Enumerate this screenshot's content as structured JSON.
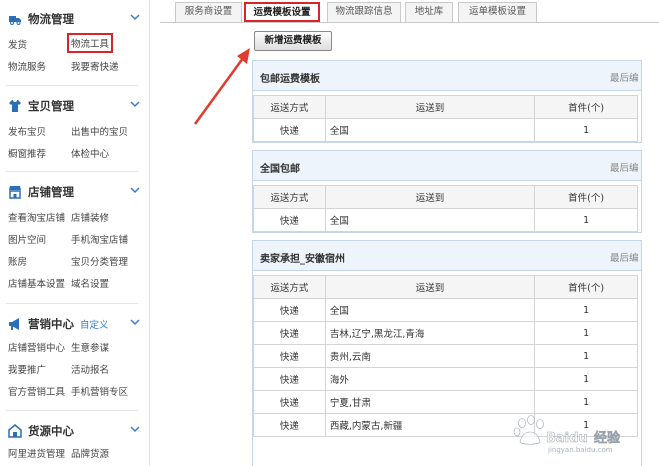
{
  "sidebar": {
    "sections": [
      {
        "title": "物流管理",
        "icon": "truck-icon",
        "links": [
          "发货",
          "物流工具",
          "物流服务",
          "我要寄快递"
        ],
        "highlighted": "物流工具"
      },
      {
        "title": "宝贝管理",
        "icon": "shirt-icon",
        "links": [
          "发布宝贝",
          "出售中的宝贝",
          "橱窗推荐",
          "体检中心"
        ]
      },
      {
        "title": "店铺管理",
        "icon": "store-icon",
        "links": [
          "查看淘宝店铺",
          "店铺装修",
          "图片空间",
          "手机淘宝店铺",
          "账房",
          "宝贝分类管理",
          "店铺基本设置",
          "域名设置"
        ]
      },
      {
        "title": "营销中心",
        "icon": "megaphone-icon",
        "extra": "自定义",
        "links": [
          "店铺营销中心",
          "生意参谋",
          "我要推广",
          "活动报名",
          "官方营销工具",
          "手机营销专区"
        ]
      },
      {
        "title": "货源中心",
        "icon": "home-icon",
        "links": [
          "阿里进货管理",
          "品牌货源"
        ]
      }
    ]
  },
  "tabs": [
    "服务商设置",
    "运费模板设置",
    "物流跟踪信息",
    "地址库",
    "运单模板设置"
  ],
  "active_tab": "运费模板设置",
  "new_template_button": "新增运费模板",
  "table_headers": {
    "method": "运送方式",
    "destination": "运送到",
    "first": "首件(个)"
  },
  "panels": [
    {
      "title": "包邮运费模板",
      "meta": "最后编",
      "rows": [
        {
          "method": "快递",
          "destination": "全国",
          "first": "1"
        }
      ]
    },
    {
      "title": "全国包邮",
      "meta": "最后编",
      "rows": [
        {
          "method": "快递",
          "destination": "全国",
          "first": "1"
        }
      ]
    },
    {
      "title": "卖家承担_安徽宿州",
      "meta": "最后编",
      "rows": [
        {
          "method": "快递",
          "destination": "全国",
          "first": "1"
        },
        {
          "method": "快递",
          "destination": "吉林,辽宁,黑龙江,青海",
          "first": "1"
        },
        {
          "method": "快递",
          "destination": "贵州,云南",
          "first": "1"
        },
        {
          "method": "快递",
          "destination": "海外",
          "first": "1"
        },
        {
          "method": "快递",
          "destination": "宁夏,甘肃",
          "first": "1"
        },
        {
          "method": "快递",
          "destination": "西藏,内蒙古,新疆",
          "first": "1"
        }
      ]
    }
  ],
  "watermark": {
    "brand": "Baidu",
    "text": "经验",
    "url": "jingyan.baidu.com"
  },
  "colors": {
    "highlight_red": "#d8242a",
    "panel_header_bg": "#eef4fb",
    "link_blue": "#2d7ad0",
    "icon_blue": "#2b6fb5"
  }
}
